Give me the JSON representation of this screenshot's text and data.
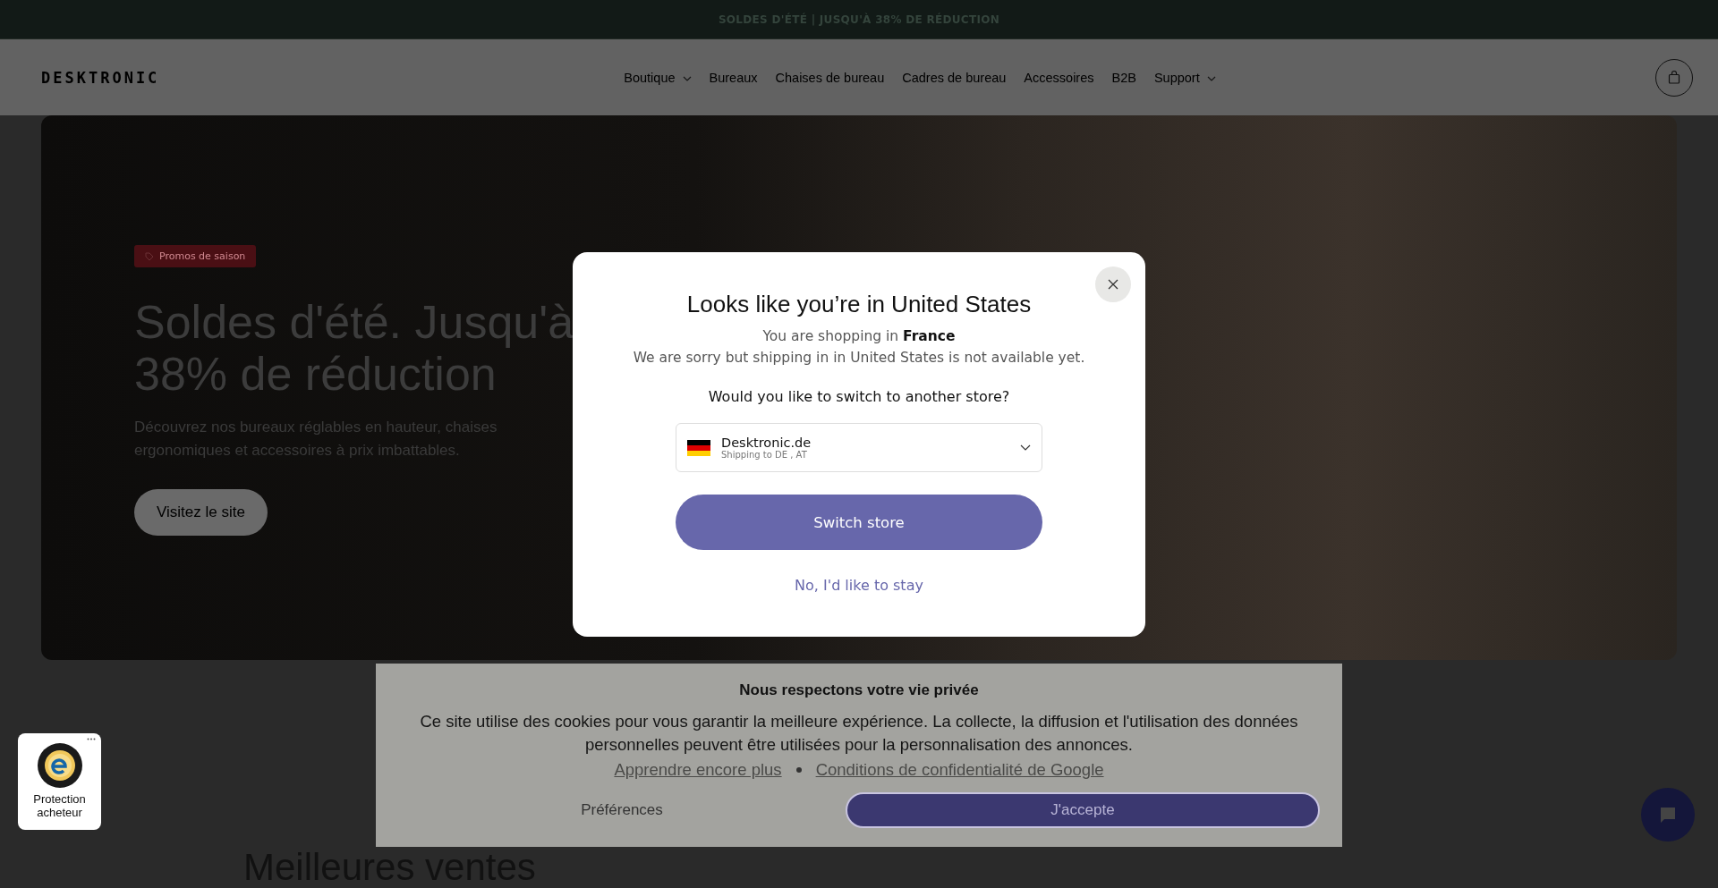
{
  "promo_bar": {
    "text": "SOLDES D'ÉTÉ | JUSQU'À 38% DE RÉDUCTION"
  },
  "header": {
    "logo": "DESKTRONIC",
    "nav": [
      {
        "label": "Boutique",
        "has_dropdown": true
      },
      {
        "label": "Bureaux",
        "has_dropdown": false
      },
      {
        "label": "Chaises de bureau",
        "has_dropdown": false
      },
      {
        "label": "Cadres de bureau",
        "has_dropdown": false
      },
      {
        "label": "Accessoires",
        "has_dropdown": false
      },
      {
        "label": "B2B",
        "has_dropdown": false
      },
      {
        "label": "Support",
        "has_dropdown": true
      }
    ]
  },
  "hero": {
    "tag": "Promos de saison",
    "title": "Soldes d'été. Jusqu'à 38% de réduction",
    "description": "Découvrez nos bureaux réglables en hauteur, chaises ergonomiques et accessoires à prix imbattables.",
    "button": "Visitez le site"
  },
  "section_heading": "Meilleures ventes",
  "modal": {
    "title": "Looks like you’re in United States",
    "shopping_line": "You are shopping in **France**",
    "sorry_text": "We are sorry but shipping in in United States is not available yet.",
    "question": "Would you like to switch to another store?",
    "store_select": {
      "name": "Desktronic.de",
      "subtitle": "Shipping to DE , AT"
    },
    "switch_button": "Switch store",
    "stay_link": "No, I'd like to stay"
  },
  "cookie_banner": {
    "title": "Nous respectons votre vie privée",
    "text": "Ce site utilise des cookies pour vous garantir la meilleure expérience. La collecte, la diffusion et l'utilisation des données personnelles peuvent être utilisées pour la personnalisation des annonces.",
    "links": [
      "Apprendre encore plus",
      "Conditions de confidentialité de Google"
    ],
    "preferences": "Préférences",
    "accept": "J'accepte"
  },
  "trust_badge": {
    "label": "Protection acheteur"
  }
}
